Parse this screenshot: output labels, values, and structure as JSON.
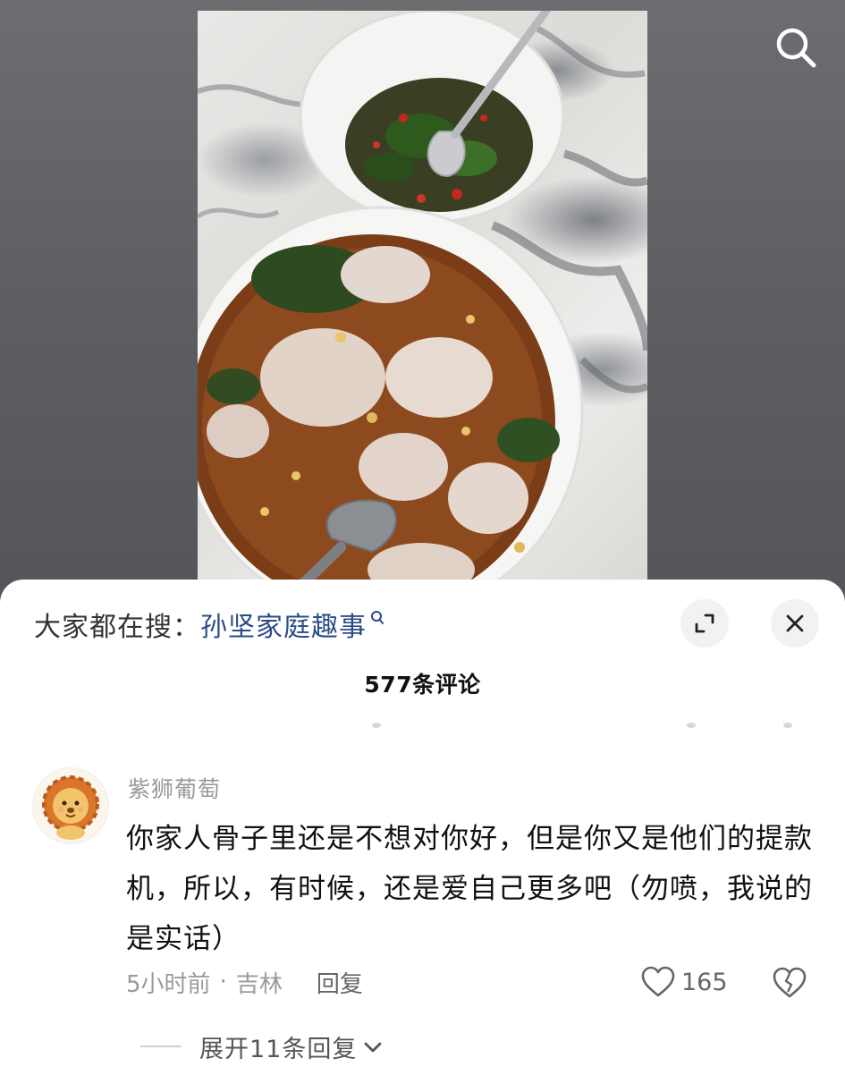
{
  "header": {
    "search_icon": "search-icon"
  },
  "photo": {
    "subject": "dumplings-in-chili-soup-with-pepper-side-bowl"
  },
  "sheet": {
    "trending_prefix": "大家都在搜：",
    "trending_query": "孙坚家庭趣事",
    "comment_count_label": "577条评论",
    "expand_icon": "expand-icon",
    "close_icon": "close-icon"
  },
  "comment": {
    "username": "紫狮葡萄",
    "text": "你家人骨子里还是不想对你好，但是你又是他们的提款机，所以，有时候，还是爱自己更多吧（勿喷，我说的是实话）",
    "time": "5小时前",
    "location": "吉林",
    "separator": "·",
    "reply_label": "回复",
    "like_count": "165",
    "expand_replies_label": "展开11条回复"
  },
  "colors": {
    "link": "#2c4c86",
    "muted": "#9a9a9a",
    "text": "#111111"
  }
}
